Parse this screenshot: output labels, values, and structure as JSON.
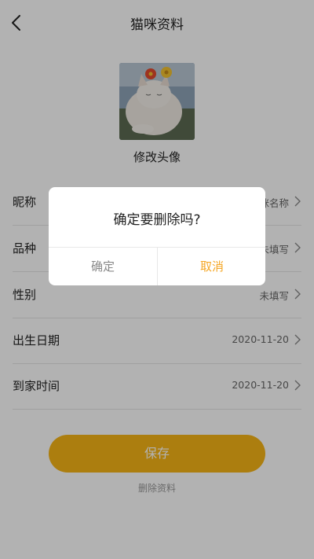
{
  "header": {
    "title": "猫咪资料",
    "back_icon": "chevron-left-icon"
  },
  "avatar": {
    "label": "修改头像"
  },
  "fields": [
    {
      "label": "昵称",
      "value": "猫咪名称"
    },
    {
      "label": "品种",
      "value": "未填写"
    },
    {
      "label": "性别",
      "value": "未填写"
    },
    {
      "label": "出生日期",
      "value": "2020-11-20"
    },
    {
      "label": "到家时间",
      "value": "2020-11-20"
    }
  ],
  "actions": {
    "save_label": "保存",
    "delete_label": "删除资料"
  },
  "dialog": {
    "message": "确定要删除吗?",
    "confirm_label": "确定",
    "cancel_label": "取消"
  },
  "colors": {
    "accent": "#f7b516",
    "dialog_cancel": "#f5a623",
    "overlay": "rgba(0,0,0,0.30)"
  }
}
